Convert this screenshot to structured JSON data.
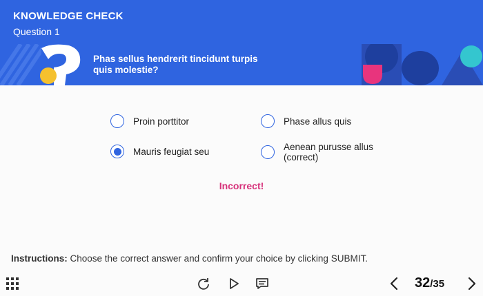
{
  "header": {
    "title": "KNOWLEDGE CHECK",
    "subtitle": "Question 1",
    "question": "Phas sellus hendrerit tincidunt turpis quis molestie?"
  },
  "options": [
    {
      "label": "Proin porttitor",
      "selected": false
    },
    {
      "label": "Phase allus quis",
      "selected": false
    },
    {
      "label": "Mauris feugiat seu",
      "selected": true
    },
    {
      "label": "Aenean purusse allus (correct)",
      "selected": false
    }
  ],
  "feedback": "Incorrect!",
  "instructions": {
    "prefix": "Instructions:",
    "text": " Choose the correct answer and confirm your choice by clicking SUBMIT."
  },
  "footer": {
    "current_page": "32",
    "total_pages": "/35",
    "icons": [
      "grid-menu-icon",
      "replay-icon",
      "play-icon",
      "captions-icon",
      "previous-icon",
      "next-icon"
    ]
  },
  "colors": {
    "accent": "#2f64e0",
    "feedback": "#d6317a",
    "pink": "#e8347d",
    "yellow": "#f5c12e",
    "teal": "#34c6cf"
  }
}
